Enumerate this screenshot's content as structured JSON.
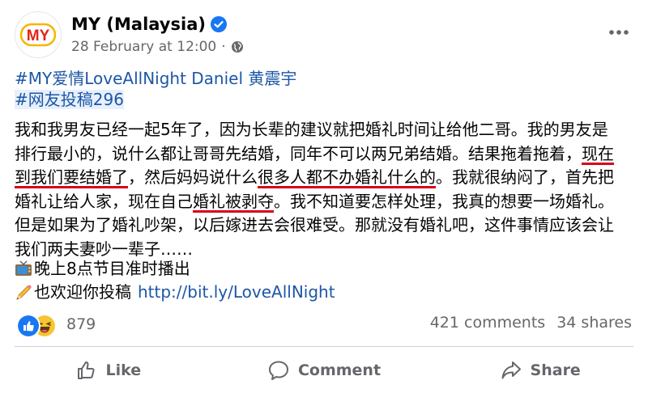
{
  "post": {
    "author": "MY (Malaysia)",
    "avatar_text": "MY",
    "timestamp": "28 February at 12:00",
    "separator": "·",
    "hashtags": [
      "#MY爱情LoveAllNight Daniel 黄震宇",
      "#网友投稿296"
    ],
    "body_lines": [
      [
        {
          "t": "我和我男友已经一起5年了，因为长辈的建议就把婚礼时间让给他二哥。我的男友是"
        }
      ],
      [
        {
          "t": "排行最小的，说什么都让哥哥先结婚，同年不可以两兄弟结婚。结果拖着拖着，"
        },
        {
          "t": "现在",
          "u": true
        }
      ],
      [
        {
          "t": "到我们要结婚了",
          "u": true
        },
        {
          "t": "，然后妈妈说什么"
        },
        {
          "t": "很多人都不办婚礼什么的",
          "u": true
        },
        {
          "t": "。我就很纳闷了，首先把"
        }
      ],
      [
        {
          "t": "婚礼让给人家，现在自己"
        },
        {
          "t": "婚礼被剥夺",
          "u": true
        },
        {
          "t": "。我不知道要怎样处理，我真的想要一场婚礼。"
        }
      ],
      [
        {
          "t": "但是如果为了婚礼吵架，以后嫁进去会很难受。那就没有婚礼吧，这件事情应该会让"
        }
      ],
      [
        {
          "t": "我们两夫妻吵一辈子……"
        }
      ]
    ],
    "promo_line1": "晚上8点节目准时播出",
    "promo_line2": "也欢迎你投稿",
    "link": "http://bit.ly/LoveAllNight",
    "reaction_count": "879",
    "comments": "421 comments",
    "shares": "34 shares",
    "actions": {
      "like": "Like",
      "comment": "Comment",
      "share": "Share"
    }
  },
  "icons": {
    "verified": "verified-badge-icon",
    "globe": "globe-icon",
    "more": "more-horizontal-icon",
    "tv": "tv-icon",
    "pencil": "pencil-icon",
    "like_reaction": "like-reaction-icon",
    "haha_reaction": "haha-reaction-icon"
  },
  "colors": {
    "link": "#1d57a5",
    "underline": "#d8001b",
    "verified": "#1877f2",
    "muted": "#65676b",
    "avatar_brand": "#e1251b"
  }
}
